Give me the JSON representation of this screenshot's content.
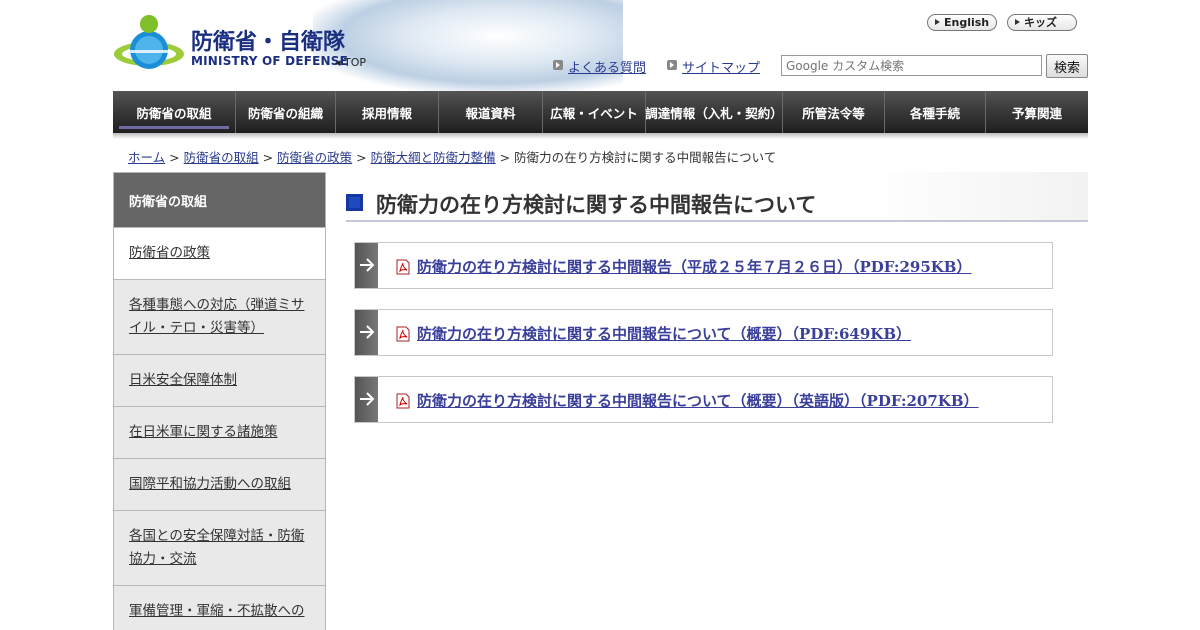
{
  "header": {
    "logo_jp": "防衛省・自衛隊",
    "logo_en": "MINISTRY OF DEFENSE",
    "top_link": "TOP",
    "english_button": "English",
    "kids_button": "キッズ",
    "faq_link": "よくある質問",
    "sitemap_link": "サイトマップ",
    "search_placeholder": "Google カスタム検索",
    "search_button": "検索"
  },
  "nav": {
    "items": [
      {
        "label": "防衛省の取組"
      },
      {
        "label": "防衛省の組織"
      },
      {
        "label": "採用情報"
      },
      {
        "label": "報道資料"
      },
      {
        "label": "広報・イベント"
      },
      {
        "label": "調達情報（入札・契約）"
      },
      {
        "label": "所管法令等"
      },
      {
        "label": "各種手続"
      },
      {
        "label": "予算関連"
      }
    ]
  },
  "breadcrumb": {
    "items": [
      "ホーム",
      "防衛省の取組",
      "防衛省の政策",
      "防衛大綱と防衛力整備"
    ],
    "current": "防衛力の在り方検討に関する中間報告について"
  },
  "sidebar": {
    "heading": "防衛省の取組",
    "items": [
      {
        "label": "防衛省の政策"
      },
      {
        "label": "各種事態への対応（弾道ミサイル・テロ・災害等）"
      },
      {
        "label": "日米安全保障体制"
      },
      {
        "label": "在日米軍に関する諸施策"
      },
      {
        "label": "国際平和協力活動への取組"
      },
      {
        "label": "各国との安全保障対話・防衛協力・交流"
      },
      {
        "label": "軍備管理・軍縮・不拡散への"
      }
    ]
  },
  "main": {
    "title": "防衛力の在り方検討に関する中間報告について",
    "links": [
      {
        "label": "防衛力の在り方検討に関する中間報告（平成２５年７月２６日）（PDF:295KB）"
      },
      {
        "label": "防衛力の在り方検討に関する中間報告について（概要）（PDF:649KB）"
      },
      {
        "label": "防衛力の在り方検討に関する中間報告について（概要）（英語版）（PDF:207KB）"
      }
    ]
  },
  "colors": {
    "nav_bg": "#2e2e2e",
    "link": "#3a3f9a",
    "title_marker": "#1437a3",
    "sidebar_head": "#666666"
  }
}
